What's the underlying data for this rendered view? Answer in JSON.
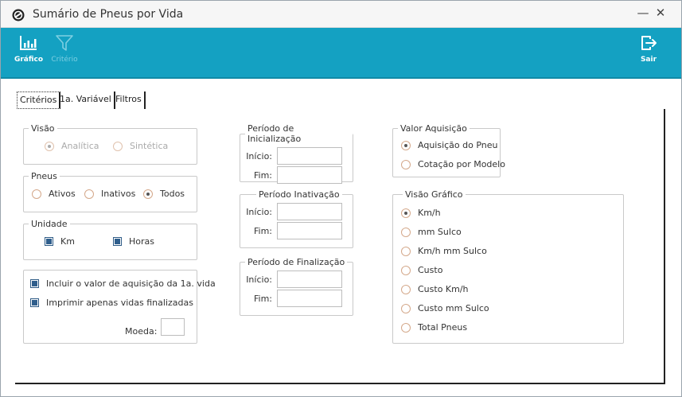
{
  "window": {
    "title": "Sumário de Pneus por Vida",
    "minimize_symbol": "—",
    "close_symbol": "✕"
  },
  "toolbar": {
    "items": [
      {
        "label": "Gráfico",
        "icon": "bar-chart-icon",
        "enabled": true
      },
      {
        "label": "Critério",
        "icon": "filter-icon",
        "enabled": false
      },
      {
        "label": "Sair",
        "icon": "exit-icon",
        "enabled": true
      }
    ]
  },
  "tabs": [
    {
      "label": "Critérios",
      "active": true
    },
    {
      "label": "1a. Variável",
      "active": false
    },
    {
      "label": "Filtros",
      "active": false
    }
  ],
  "visao": {
    "legend": "Visão",
    "options": [
      {
        "label": "Analítica",
        "selected": true,
        "enabled": false
      },
      {
        "label": "Sintética",
        "selected": false,
        "enabled": false
      }
    ]
  },
  "pneus": {
    "legend": "Pneus",
    "options": [
      {
        "label": "Ativos",
        "selected": false
      },
      {
        "label": "Inativos",
        "selected": false
      },
      {
        "label": "Todos",
        "selected": true
      }
    ]
  },
  "unidade": {
    "legend": "Unidade",
    "options": [
      {
        "label": "Km",
        "checked": true
      },
      {
        "label": "Horas",
        "checked": true
      }
    ]
  },
  "opcoes": {
    "incluir_label": "Incluir o valor de aquisição da 1a. vida",
    "imprimir_label": "Imprimir apenas vidas finalizadas",
    "moeda_label": "Moeda:",
    "moeda_value": ""
  },
  "periodo_inicializacao": {
    "legend": "Período de Inicialização",
    "inicio_label": "Início:",
    "fim_label": "Fim:",
    "inicio_value": "",
    "fim_value": ""
  },
  "periodo_inativacao": {
    "legend": "Período Inativação",
    "inicio_label": "Início:",
    "fim_label": "Fim:",
    "inicio_value": "",
    "fim_value": ""
  },
  "periodo_finalizacao": {
    "legend": "Período de Finalização",
    "inicio_label": "Início:",
    "fim_label": "Fim:",
    "inicio_value": "",
    "fim_value": ""
  },
  "valor_aquisicao": {
    "legend": "Valor Aquisição",
    "options": [
      {
        "label": "Aquisição do Pneu",
        "selected": true
      },
      {
        "label": "Cotação por Modelo",
        "selected": false
      }
    ]
  },
  "visao_grafico": {
    "legend": "Visão Gráfico",
    "options": [
      {
        "label": "Km/h",
        "selected": true
      },
      {
        "label": "mm Sulco",
        "selected": false
      },
      {
        "label": "Km/h mm Sulco",
        "selected": false
      },
      {
        "label": "Custo",
        "selected": false
      },
      {
        "label": "Custo Km/h",
        "selected": false
      },
      {
        "label": "Custo mm Sulco",
        "selected": false
      },
      {
        "label": "Total Pneus",
        "selected": false
      }
    ]
  }
}
